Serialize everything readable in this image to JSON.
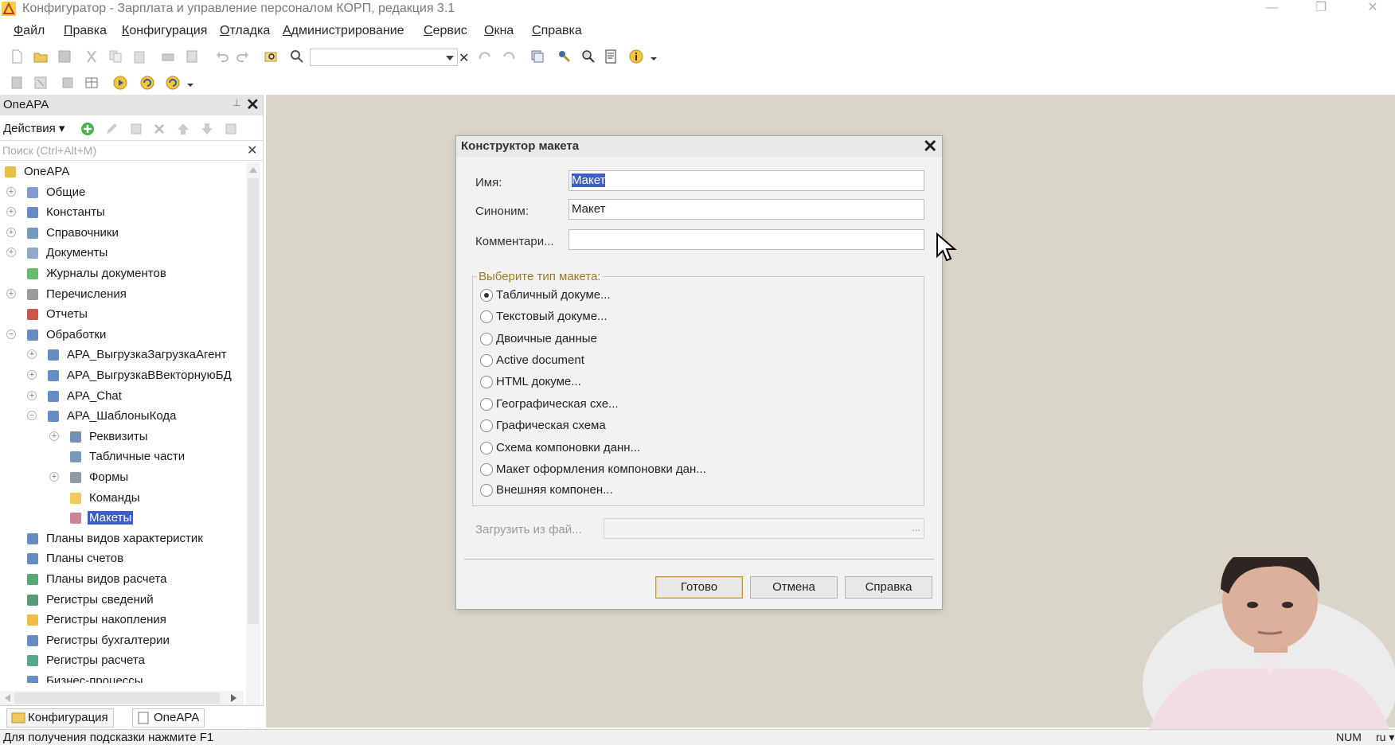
{
  "window": {
    "title": "Конфигуратор - Зарплата и управление персоналом КОРП, редакция 3.1",
    "app_icon": "1c-app-icon",
    "minimize": "—",
    "restore": "❐",
    "close": "✕"
  },
  "menu": [
    "Файл",
    "Правка",
    "Конфигурация",
    "Отладка",
    "Администрирование",
    "Сервис",
    "Окна",
    "Справка"
  ],
  "toolbar": {
    "search_value": "",
    "search_clear": "✕"
  },
  "panel": {
    "title": "OneAPA",
    "pin": "⊥",
    "close": "✕",
    "actions_label": "Действия ▾",
    "search_placeholder": "Поиск (Ctrl+Alt+M)",
    "search_clear": "✕"
  },
  "tree": [
    {
      "label": "OneAPA",
      "icon": "config-root-icon",
      "expander": ""
    },
    {
      "label": "Общие",
      "icon": "common-icon",
      "expander": "+"
    },
    {
      "label": "Константы",
      "icon": "constants-icon",
      "expander": "+"
    },
    {
      "label": "Справочники",
      "icon": "catalogs-icon",
      "expander": "+"
    },
    {
      "label": "Документы",
      "icon": "documents-icon",
      "expander": "+"
    },
    {
      "label": "Журналы документов",
      "icon": "journals-icon",
      "expander": ""
    },
    {
      "label": "Перечисления",
      "icon": "enums-icon",
      "expander": "+"
    },
    {
      "label": "Отчеты",
      "icon": "reports-icon",
      "expander": ""
    },
    {
      "label": "Обработки",
      "icon": "dataprocessors-icon",
      "expander": "−"
    },
    {
      "label": "APA_ВыгрузкаЗагрузкаАгент",
      "icon": "dataprocessor-icon",
      "expander": "+"
    },
    {
      "label": "APA_ВыгрузкаВВекторнуюБД",
      "icon": "dataprocessor-icon",
      "expander": "+"
    },
    {
      "label": "APA_Chat",
      "icon": "dataprocessor-icon",
      "expander": "+"
    },
    {
      "label": "APA_ШаблоныКода",
      "icon": "dataprocessor-icon",
      "expander": "−"
    },
    {
      "label": "Реквизиты",
      "icon": "attributes-icon",
      "expander": "+"
    },
    {
      "label": "Табличные части",
      "icon": "tabular-sections-icon",
      "expander": ""
    },
    {
      "label": "Формы",
      "icon": "forms-icon",
      "expander": "+"
    },
    {
      "label": "Команды",
      "icon": "commands-icon",
      "expander": ""
    },
    {
      "label": "Макеты",
      "icon": "templates-icon",
      "expander": "",
      "selected": true
    },
    {
      "label": "Планы видов характеристик",
      "icon": "chart-of-characteristic-types-icon",
      "expander": ""
    },
    {
      "label": "Планы счетов",
      "icon": "chart-of-accounts-icon",
      "expander": ""
    },
    {
      "label": "Планы видов расчета",
      "icon": "chart-of-calculation-types-icon",
      "expander": ""
    },
    {
      "label": "Регистры сведений",
      "icon": "information-registers-icon",
      "expander": ""
    },
    {
      "label": "Регистры накопления",
      "icon": "accumulation-registers-icon",
      "expander": ""
    },
    {
      "label": "Регистры бухгалтерии",
      "icon": "accounting-registers-icon",
      "expander": ""
    },
    {
      "label": "Регистры расчета",
      "icon": "calculation-registers-icon",
      "expander": ""
    },
    {
      "label": "Бизнес-процессы",
      "icon": "business-processes-icon",
      "expander": ""
    }
  ],
  "window_tabs": [
    "Конфигурация",
    "OneAPA"
  ],
  "status": {
    "hint": "Для получения подсказки нажмите F1",
    "num": "NUM",
    "lang": "ru ▾"
  },
  "dialog": {
    "title": "Конструктор макета",
    "close": "✕",
    "name_label": "Имя:",
    "name_value": "Макет",
    "synonym_label": "Синоним:",
    "synonym_value": "Макет",
    "comment_label": "Комментари...",
    "comment_value": "",
    "type_group_label": "Выберите тип макета:",
    "types": [
      {
        "label": "Табличный докуме...",
        "checked": true
      },
      {
        "label": "Текстовый докуме...",
        "checked": false
      },
      {
        "label": "Двоичные данные",
        "checked": false
      },
      {
        "label": "Active document",
        "checked": false
      },
      {
        "label": "HTML докуме...",
        "checked": false
      },
      {
        "label": "Географическая схе...",
        "checked": false
      },
      {
        "label": "Графическая схема",
        "checked": false
      },
      {
        "label": "Схема компоновки данн...",
        "checked": false
      },
      {
        "label": "Макет оформления компоновки дан...",
        "checked": false
      },
      {
        "label": "Внешняя компонен...",
        "checked": false
      }
    ],
    "load_label": "Загрузить из фай...",
    "load_button": "...",
    "buttons": {
      "ok": "Готово",
      "cancel": "Отмена",
      "help": "Справка"
    }
  },
  "colors": {
    "selection": "#3d5ec8",
    "workspace": "#d9d6c9",
    "group_title": "#9a7a2a"
  }
}
